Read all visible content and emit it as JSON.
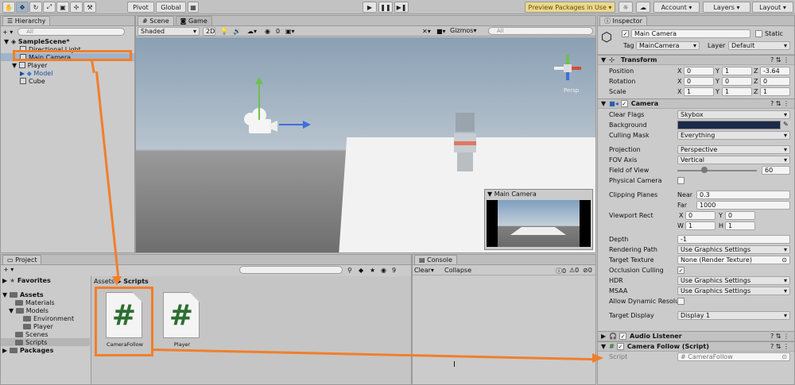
{
  "toolbar": {
    "pivot": "Pivot",
    "global": "Global",
    "preview": "Preview Packages in Use",
    "account": "Account",
    "layers": "Layers",
    "layout": "Layout",
    "play_icon": "play-icon",
    "pause_icon": "pause-icon",
    "step_icon": "step-icon"
  },
  "hierarchy": {
    "tab": "Hierarchy",
    "search_placeholder": "All",
    "items": [
      "SampleScene*",
      "Directional Light",
      "Main Camera",
      "Player",
      "Model",
      "Cube"
    ]
  },
  "scene": {
    "tab_scene": "Scene",
    "tab_game": "Game",
    "shading": "Shaded",
    "mode_2d": "2D",
    "layer_count": "0",
    "gizmos": "Gizmos",
    "search_placeholder": "All",
    "persp": "Persp",
    "preview_title": "Main Camera"
  },
  "project": {
    "tab": "Project",
    "count": "9",
    "breadcrumb_root": "Assets",
    "breadcrumb_sep": "▶",
    "breadcrumb_current": "Scripts",
    "tree": [
      "Favorites",
      "Assets",
      "Materials",
      "Models",
      "Environment",
      "Player",
      "Scenes",
      "Scripts",
      "Packages"
    ],
    "files": [
      {
        "name": "CameraFollow",
        "glyph": "#"
      },
      {
        "name": "Player",
        "glyph": "#"
      }
    ]
  },
  "console": {
    "tab": "Console",
    "clear": "Clear",
    "collapse": "Collapse",
    "c1": "0",
    "c2": "0",
    "c3": "0"
  },
  "inspector": {
    "tab": "Inspector",
    "object_name": "Main Camera",
    "static": "Static",
    "tag_label": "Tag",
    "tag": "MainCamera",
    "layer_label": "Layer",
    "layer": "Default",
    "transform": {
      "title": "Transform",
      "rows": [
        {
          "label": "Position",
          "x": "0",
          "y": "1",
          "z": "-3.64"
        },
        {
          "label": "Rotation",
          "x": "0",
          "y": "0",
          "z": "0"
        },
        {
          "label": "Scale",
          "x": "1",
          "y": "1",
          "z": "1"
        }
      ],
      "ax": "X",
      "ay": "Y",
      "az": "Z"
    },
    "camera": {
      "title": "Camera",
      "clear_flags_label": "Clear Flags",
      "clear_flags": "Skybox",
      "background_label": "Background",
      "background_color": "#1b2a4a",
      "culling_label": "Culling Mask",
      "culling": "Everything",
      "projection_label": "Projection",
      "projection": "Perspective",
      "fov_axis_label": "FOV Axis",
      "fov_axis": "Vertical",
      "fov_label": "Field of View",
      "fov": "60",
      "fov_fraction": 0.33,
      "physical_label": "Physical Camera",
      "clip_label": "Clipping Planes",
      "near_label": "Near",
      "near": "0.3",
      "far_label": "Far",
      "far": "1000",
      "viewport_label": "Viewport Rect",
      "vx": "0",
      "vy": "0",
      "vw": "1",
      "vh": "1",
      "vx_l": "X",
      "vy_l": "Y",
      "vw_l": "W",
      "vh_l": "H",
      "depth_label": "Depth",
      "depth": "-1",
      "rendering_label": "Rendering Path",
      "rendering": "Use Graphics Settings",
      "target_tex_label": "Target Texture",
      "target_tex": "None (Render Texture)",
      "occlusion_label": "Occlusion Culling",
      "hdr_label": "HDR",
      "hdr": "Use Graphics Settings",
      "msaa_label": "MSAA",
      "msaa": "Use Graphics Settings",
      "dyn_label": "Allow Dynamic Resoluti",
      "target_disp_label": "Target Display",
      "target_disp": "Display 1"
    },
    "audio": {
      "title": "Audio Listener"
    },
    "script": {
      "title": "Camera Follow (Script)",
      "label": "Script",
      "value": "CameraFollow"
    }
  },
  "colors": {
    "accent": "#f07f2c",
    "selection": "#9fb4cc",
    "sky": "#8aa0b4",
    "ground": "#6e6e6e"
  }
}
